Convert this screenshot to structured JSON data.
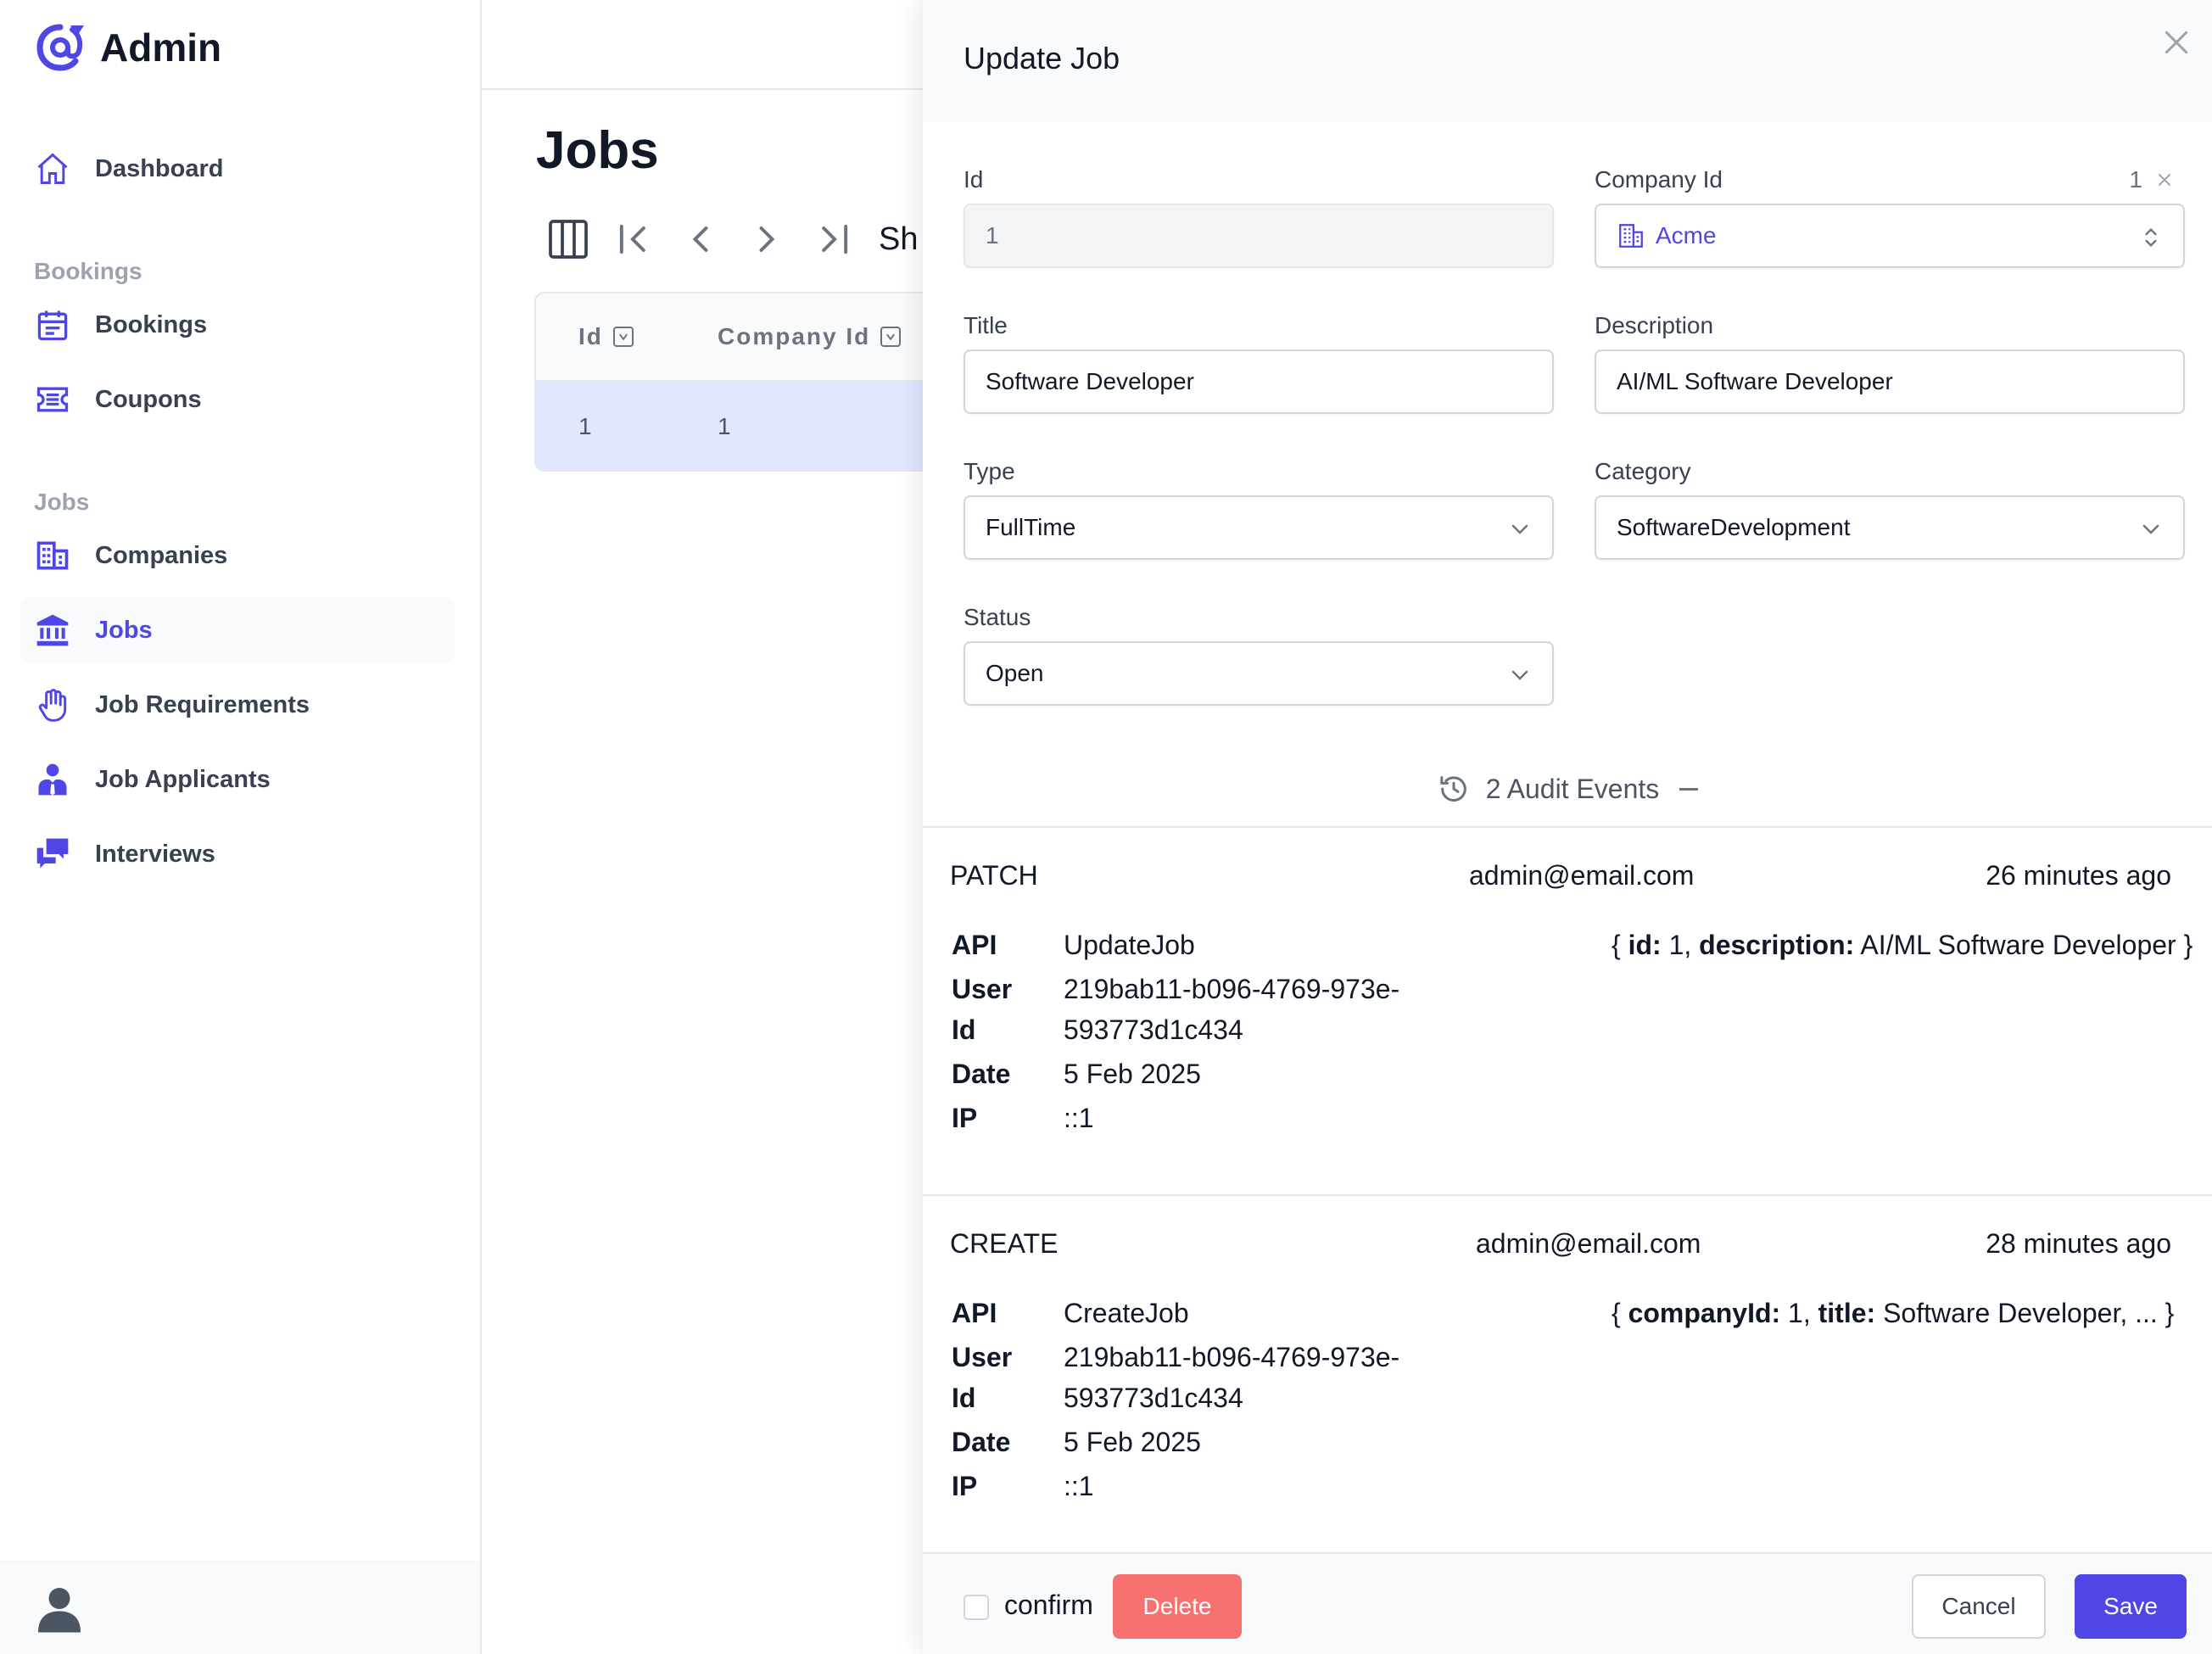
{
  "brand": {
    "name": "Admin"
  },
  "sidebar": {
    "items": [
      {
        "label": "Dashboard",
        "icon": "home-icon"
      },
      {
        "label": "Bookings",
        "icon": "calendar-icon"
      },
      {
        "label": "Coupons",
        "icon": "ticket-icon"
      },
      {
        "label": "Companies",
        "icon": "building-icon"
      },
      {
        "label": "Jobs",
        "icon": "bank-icon",
        "active": true
      },
      {
        "label": "Job Requirements",
        "icon": "hand-icon"
      },
      {
        "label": "Job Applicants",
        "icon": "user-tie-icon"
      },
      {
        "label": "Interviews",
        "icon": "chat-icon"
      }
    ],
    "sections": {
      "bookings": "Bookings",
      "jobs": "Jobs"
    }
  },
  "page": {
    "title": "Jobs",
    "toolbar_partial": "Sh"
  },
  "grid": {
    "columns": [
      "Id",
      "Company Id"
    ],
    "rows": [
      {
        "id": "1",
        "company_id": "1"
      }
    ]
  },
  "modal": {
    "title": "Update Job",
    "fields": {
      "id": {
        "label": "Id",
        "value": "1"
      },
      "company_id": {
        "label": "Company Id",
        "value": "Acme",
        "meta_id": "1"
      },
      "title": {
        "label": "Title",
        "value": "Software Developer"
      },
      "description": {
        "label": "Description",
        "value": "AI/ML Software Developer"
      },
      "type": {
        "label": "Type",
        "value": "FullTime"
      },
      "category": {
        "label": "Category",
        "value": "SoftwareDevelopment"
      },
      "status": {
        "label": "Status",
        "value": "Open"
      }
    },
    "audit": {
      "toggle_label": "2 Audit Events",
      "keys": {
        "api": "API",
        "user": "User",
        "id": "Id",
        "date": "Date",
        "ip": "IP"
      },
      "events": [
        {
          "op": "PATCH",
          "user": "admin@email.com",
          "time": "26 minutes ago",
          "api": "UpdateJob",
          "user_id_1": "219bab11-b096-4769-973e-",
          "user_id_2": "593773d1c434",
          "date": "5 Feb 2025",
          "ip": "::1",
          "body": {
            "open": "{",
            "k1": "id:",
            "v1": " 1,",
            "k2": " description:",
            "v2": " AI/ML Software Developer",
            "close": " }"
          }
        },
        {
          "op": "CREATE",
          "user": "admin@email.com",
          "time": "28 minutes ago",
          "api": "CreateJob",
          "user_id_1": "219bab11-b096-4769-973e-",
          "user_id_2": "593773d1c434",
          "date": "5 Feb 2025",
          "ip": "::1",
          "body": {
            "open": "{",
            "k1": " companyId:",
            "v1": " 1,",
            "k2": " title:",
            "v2": " Software Developer, ...",
            "close": " }"
          }
        }
      ]
    },
    "footer": {
      "confirm_label": "confirm",
      "delete_label": "Delete",
      "cancel_label": "Cancel",
      "save_label": "Save"
    }
  },
  "colors": {
    "accent": "#4f46e5",
    "danger": "#f87171",
    "selected_row": "#e0e7ff"
  }
}
